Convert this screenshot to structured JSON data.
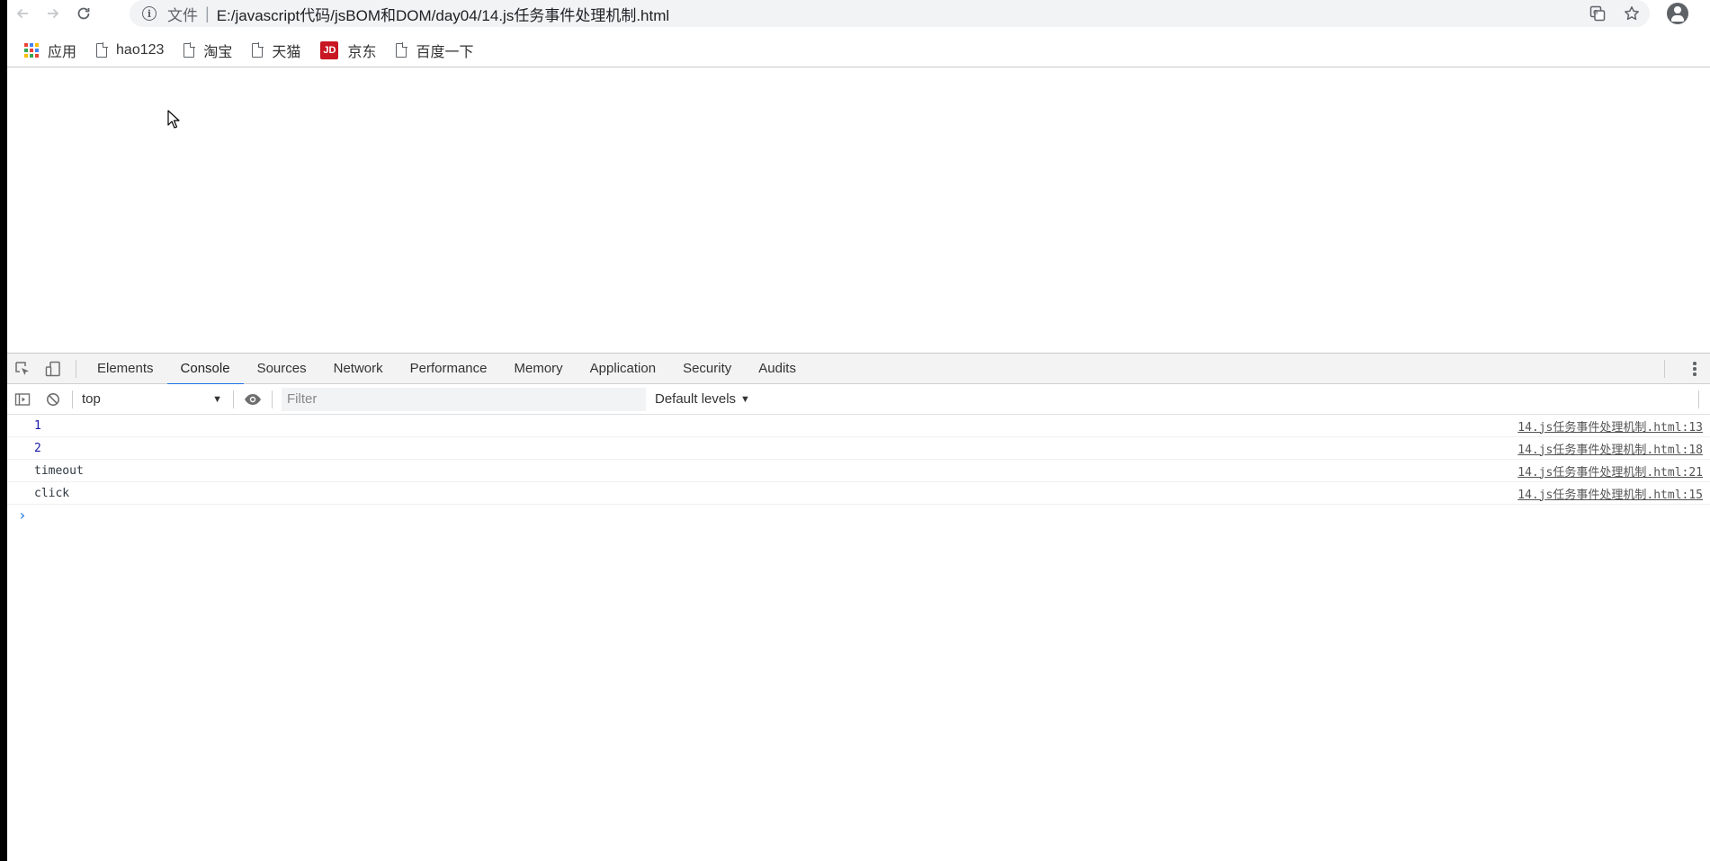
{
  "browser": {
    "omnibox": {
      "scheme_label": "文件",
      "url": "E:/javascript代码/jsBOM和DOM/day04/14.js任务事件处理机制.html"
    },
    "bookmarks": [
      {
        "label": "应用",
        "icon": "apps-icon"
      },
      {
        "label": "hao123",
        "icon": "page-icon"
      },
      {
        "label": "淘宝",
        "icon": "page-icon"
      },
      {
        "label": "天猫",
        "icon": "page-icon"
      },
      {
        "label": "京东",
        "icon": "jd-icon"
      },
      {
        "label": "百度一下",
        "icon": "page-icon"
      }
    ],
    "jd_icon_text": "JD"
  },
  "devtools": {
    "tabs": [
      "Elements",
      "Console",
      "Sources",
      "Network",
      "Performance",
      "Memory",
      "Application",
      "Security",
      "Audits"
    ],
    "active_tab": "Console",
    "console_bar": {
      "context": "top",
      "filter_placeholder": "Filter",
      "levels": "Default levels"
    },
    "messages": [
      {
        "value": "1",
        "type": "number",
        "source": "14.js任务事件处理机制.html:13"
      },
      {
        "value": "2",
        "type": "number",
        "source": "14.js任务事件处理机制.html:18"
      },
      {
        "value": "timeout",
        "type": "string",
        "source": "14.js任务事件处理机制.html:21"
      },
      {
        "value": "click",
        "type": "string",
        "source": "14.js任务事件处理机制.html:15"
      }
    ],
    "prompt_symbol": "›"
  },
  "colors": {
    "accent": "#1a73e8",
    "number_value": "#1a1aa6",
    "jd_red": "#c81623"
  }
}
